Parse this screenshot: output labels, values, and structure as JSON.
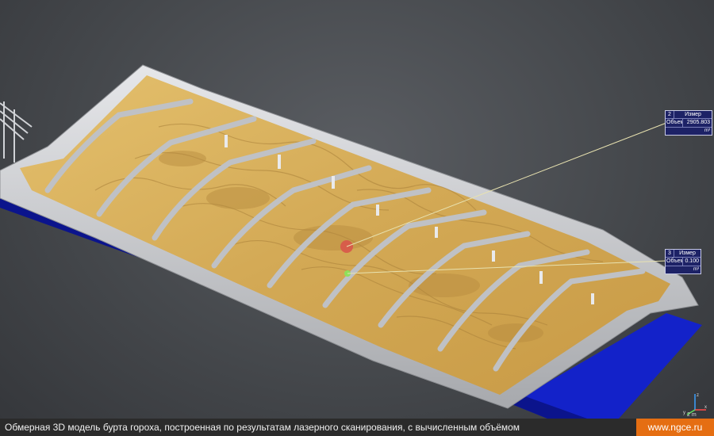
{
  "caption": "Обмерная 3D модель бурта гороха, построенная по результатам лазерного сканирования, с вычисленным объёмом",
  "site": "www.ngce.ru",
  "measurements": [
    {
      "num": "2",
      "title": "Измер",
      "label": "Объем",
      "value": "2905.803",
      "unit": "m³"
    },
    {
      "num": "3",
      "title": "Измер",
      "label": "Объем",
      "value": "0.100",
      "unit": "m³"
    }
  ],
  "axes": {
    "x": "x",
    "y": "y",
    "z": "z",
    "scale": "2 m"
  },
  "colors": {
    "background": "#45484c",
    "pile": "#d7ae58",
    "walls": "#c2c4c8",
    "water": "#1322c9",
    "tag": "#1d2266",
    "brand": "#e56e12"
  }
}
